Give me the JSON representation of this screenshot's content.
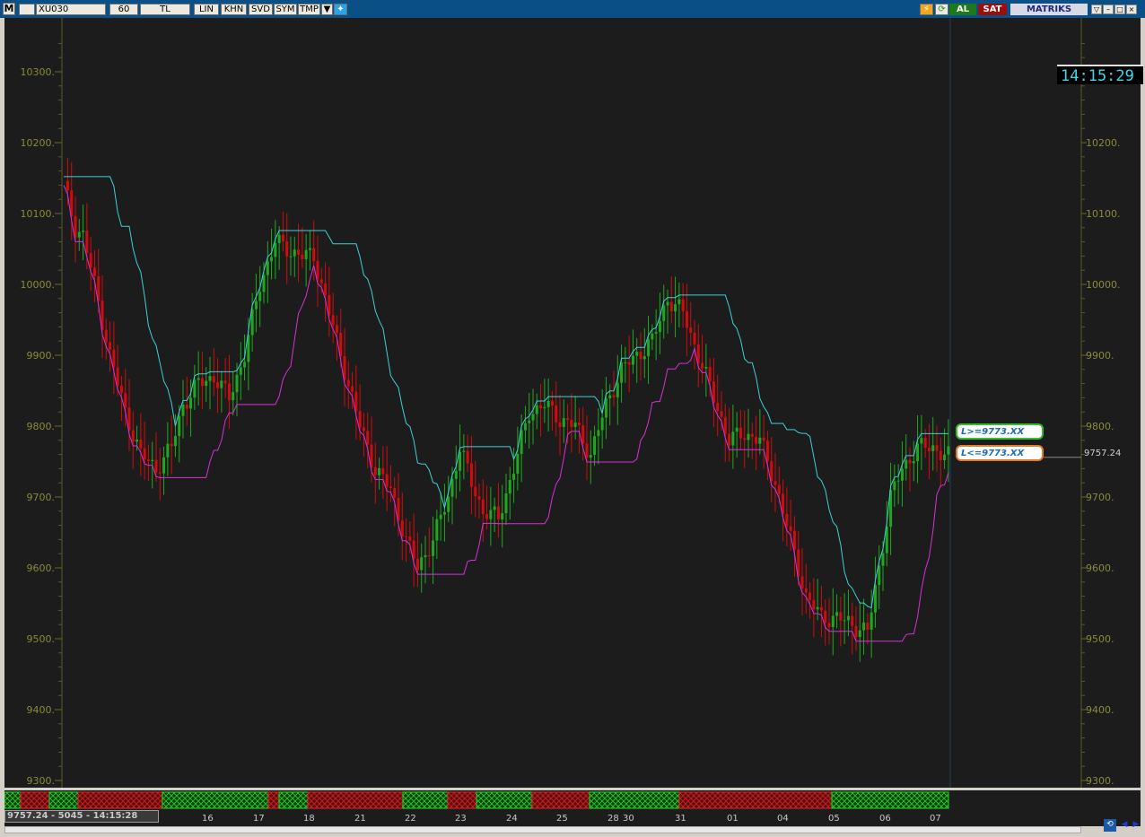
{
  "toolbar": {
    "menu_label": "M",
    "symbol": "XU030",
    "period": "60",
    "currency": "TL",
    "buttons": [
      "LIN",
      "KHN",
      "SVD",
      "SYM",
      "TMP"
    ],
    "buy_label": "AL",
    "sell_label": "SAT",
    "brand": "MATRIKS",
    "icons": [
      "lightning-icon",
      "refresh-icon",
      "twitter-icon",
      "dropdown-icon"
    ]
  },
  "clock": "14:15:29",
  "alerts": {
    "above": "L>=9773.XX",
    "below": "L<=9773.XX"
  },
  "last_price": "9757.24",
  "status_readout": "9757.24 - 5045 - 14:15:28",
  "colors": {
    "up": "#1fa81f",
    "down": "#d10c0c",
    "upper_band": "#3fd0d6",
    "lower_band": "#d631d6",
    "axis_text": "#8a8a3a",
    "grid_tick": "#7a7a2a",
    "background": "#1c1c1c"
  },
  "chart_data": {
    "type": "candlestick",
    "ylim": [
      9300,
      10350
    ],
    "y_ticks": [
      9300,
      9400,
      9500,
      9600,
      9700,
      9800,
      9900,
      10000,
      10100,
      10200,
      10300
    ],
    "y_tick_labels_left": [
      "9300.",
      "9400.",
      "9500.",
      "9600.",
      "9700.",
      "9800.",
      "9900.",
      "10000.",
      "10100.",
      "10200.",
      "10300."
    ],
    "y_tick_labels_right": [
      "9300.",
      "9400.",
      "9500.",
      "9600.",
      "9700.",
      "9800.",
      "9900.",
      "10000.",
      "10100.",
      "10200."
    ],
    "x_labels": [
      "16",
      "17",
      "18",
      "21",
      "22",
      "23",
      "24",
      "25",
      "28",
      "30",
      "31",
      "01",
      "04",
      "05",
      "06",
      "07"
    ],
    "close_anchors": [
      [
        0,
        10140
      ],
      [
        3,
        10080
      ],
      [
        5,
        10070
      ],
      [
        8,
        10000
      ],
      [
        12,
        9900
      ],
      [
        16,
        9820
      ],
      [
        20,
        9760
      ],
      [
        24,
        9740
      ],
      [
        28,
        9770
      ],
      [
        31,
        9830
      ],
      [
        35,
        9860
      ],
      [
        39,
        9870
      ],
      [
        43,
        9840
      ],
      [
        47,
        9900
      ],
      [
        51,
        10000
      ],
      [
        55,
        10060
      ],
      [
        58,
        10050
      ],
      [
        62,
        10040
      ],
      [
        65,
        10040
      ],
      [
        69,
        9960
      ],
      [
        73,
        9880
      ],
      [
        77,
        9800
      ],
      [
        81,
        9740
      ],
      [
        85,
        9710
      ],
      [
        89,
        9640
      ],
      [
        92,
        9600
      ],
      [
        96,
        9640
      ],
      [
        100,
        9700
      ],
      [
        103,
        9770
      ],
      [
        106,
        9720
      ],
      [
        109,
        9680
      ],
      [
        113,
        9670
      ],
      [
        117,
        9740
      ],
      [
        121,
        9820
      ],
      [
        125,
        9830
      ],
      [
        129,
        9810
      ],
      [
        133,
        9800
      ],
      [
        137,
        9760
      ],
      [
        141,
        9830
      ],
      [
        145,
        9880
      ],
      [
        149,
        9900
      ],
      [
        153,
        9920
      ],
      [
        157,
        9980
      ],
      [
        161,
        9960
      ],
      [
        165,
        9900
      ],
      [
        169,
        9840
      ],
      [
        173,
        9780
      ],
      [
        177,
        9790
      ],
      [
        181,
        9780
      ],
      [
        185,
        9720
      ],
      [
        189,
        9640
      ],
      [
        193,
        9560
      ],
      [
        197,
        9530
      ],
      [
        201,
        9530
      ],
      [
        205,
        9520
      ],
      [
        209,
        9510
      ],
      [
        212,
        9600
      ],
      [
        215,
        9700
      ],
      [
        218,
        9740
      ],
      [
        222,
        9770
      ],
      [
        226,
        9770
      ],
      [
        230,
        9757
      ]
    ]
  }
}
